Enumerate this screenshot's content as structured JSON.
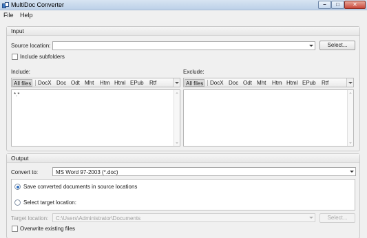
{
  "window": {
    "title": "MultiDoc Converter"
  },
  "menu": {
    "file": "File",
    "help": "Help"
  },
  "input": {
    "header": "Input",
    "source_label": "Source location:",
    "source_value": "",
    "select_button": "Select...",
    "include_subfolders_label": "Include subfolders",
    "include_subfolders_checked": false,
    "include": {
      "label": "Include:",
      "tabs": [
        "All files",
        "DocX",
        "Doc",
        "Odt",
        "Mht",
        "Htm",
        "Html",
        "EPub",
        "Rtf"
      ],
      "active_tab": "All files",
      "entries": [
        "*.*"
      ]
    },
    "exclude": {
      "label": "Exclude:",
      "tabs": [
        "All files",
        "DocX",
        "Doc",
        "Odt",
        "Mht",
        "Htm",
        "Html",
        "EPub",
        "Rtf"
      ],
      "active_tab": "All files",
      "entries": []
    }
  },
  "output": {
    "header": "Output",
    "convert_to_label": "Convert to:",
    "convert_to_value": "MS Word 97-2003 (*.doc)",
    "radio_source_label": "Save converted documents in source locations",
    "radio_target_label": "Select target location:",
    "selected_radio": "source",
    "target_label": "Target location:",
    "target_value": "C:\\Users\\Administrator\\Documents",
    "target_select_button": "Select...",
    "overwrite_label": "Overwrite existing files",
    "overwrite_checked": false
  }
}
